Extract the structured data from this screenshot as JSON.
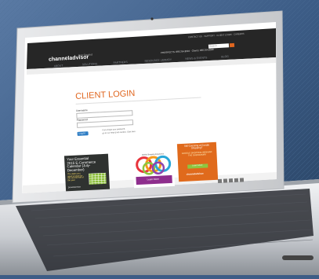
{
  "site": {
    "logo": "channeladvisor",
    "logo_tag": "Get Started",
    "top_links": "CONTACT US · SUPPORT · CLIENT LOGIN · CAREERS",
    "phone": "PROSPECTS: 866.264.8594 · Clients: 866.264.8596",
    "search_label": "Search",
    "nav": [
      "ABOUT",
      "SOLUTIONS",
      "PARTNERS",
      "RESOURCE LIBRARY",
      "NEWS & EVENTS",
      "BLOG"
    ]
  },
  "login": {
    "title": "CLIENT LOGIN",
    "username_label": "Username",
    "password_label": "Password",
    "login_button": "Log In",
    "help_text_1": "If you forgot your password,",
    "help_text_2": "go to our Help & Info section. Click here."
  },
  "ads": [
    {
      "title": "Your Essential 2015 E-Commerce Calendar (July-December)",
      "subtitle": "The dates you need to know for the second half of the year",
      "cta": "Download Now"
    },
    {
      "title": "Mobile Shopping Experience",
      "cta": "Learn More"
    },
    {
      "title": "Still Guessing at Google Shopping?",
      "body": "GOOGLE SHOPPING WEBINAR: THE GUESSWORK",
      "cta": "Learn More",
      "brand": "channeladvisor"
    }
  ],
  "colors": {
    "accent_orange": "#e0661f",
    "nav_bar": "#262626",
    "background": "#3d5d86"
  }
}
